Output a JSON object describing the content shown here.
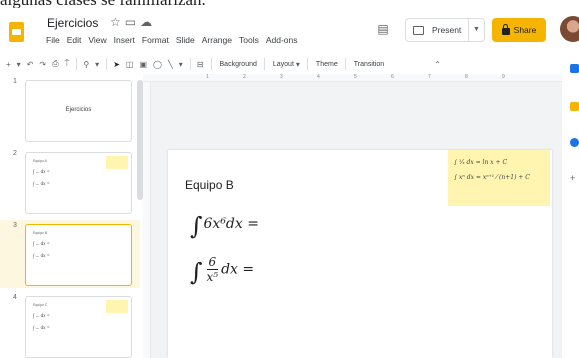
{
  "caption": "algunas clases se familiarizan.",
  "app": {
    "doc_title": "Ejercicios",
    "menu": [
      "File",
      "Edit",
      "View",
      "Insert",
      "Format",
      "Slide",
      "Arrange",
      "Tools",
      "Add-ons"
    ],
    "present_label": "Present",
    "share_label": "Share",
    "icons": {
      "logo": "slides-logo-icon",
      "star": "star-icon",
      "folder": "move-to-folder-icon",
      "cloud": "cloud-status-icon",
      "comment": "comment-icon",
      "present": "present-icon",
      "lock": "lock-icon",
      "avatar": "user-avatar"
    }
  },
  "toolbar": {
    "background_label": "Background",
    "layout_label": "Layout",
    "theme_label": "Theme",
    "transition_label": "Transition"
  },
  "ruler_ticks": [
    "1",
    "2",
    "3",
    "4",
    "5",
    "6",
    "7",
    "8",
    "9"
  ],
  "filmstrip": {
    "slides": [
      {
        "number": "1",
        "title": "Ejercicios"
      },
      {
        "number": "2",
        "label": "Equipo A"
      },
      {
        "number": "3",
        "label": "Equipo B"
      },
      {
        "number": "4",
        "label": "Equipo C"
      }
    ],
    "selected_index": 3
  },
  "slide": {
    "heading": "Equipo B",
    "expr1": "6x⁶dx =",
    "expr2_num": "6",
    "expr2_den": "x⁵",
    "expr2_tail": "dx =",
    "ref_line1": "∫ ¹⁄ₓ dx = ln x + C",
    "ref_line2": "∫ xⁿ dx = xⁿ⁺¹ ⁄ (n+1) + C"
  },
  "colors": {
    "accent": "#f5b400",
    "selected_bg": "#fef7e0",
    "note_bg": "#fff5b0"
  }
}
